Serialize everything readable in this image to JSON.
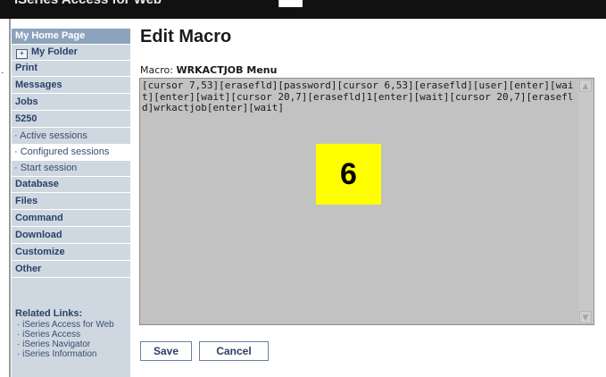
{
  "window": {
    "title_fragment": "iSeries Access for Web"
  },
  "nav": {
    "items": [
      {
        "label": "My Home Page"
      },
      {
        "label": "My Folder"
      },
      {
        "label": "Print"
      },
      {
        "label": "Messages"
      },
      {
        "label": "Jobs"
      },
      {
        "label": "5250"
      },
      {
        "label": "· Active sessions"
      },
      {
        "label": "· Configured sessions"
      },
      {
        "label": "· Start session"
      },
      {
        "label": "Database"
      },
      {
        "label": "Files"
      },
      {
        "label": "Command"
      },
      {
        "label": "Download"
      },
      {
        "label": "Customize"
      },
      {
        "label": "Other"
      }
    ],
    "related": {
      "heading": "Related Links:",
      "links": [
        "· iSeries Access for Web",
        "· iSeries Access",
        "· iSeries Navigator",
        "· iSeries Information"
      ]
    }
  },
  "main": {
    "title": "Edit Macro",
    "macro_label": "Macro: ",
    "macro_name": "WRKACTJOB Menu",
    "macro_text": "[cursor 7,53][erasefld][password][cursor 6,53][erasefld][user][enter][wait][enter][wait][cursor 20,7][erasefld]1[enter][wait][cursor 20,7][erasefld]wrkactjob[enter][wait]",
    "callout_number": "6",
    "buttons": {
      "save": "Save",
      "cancel": "Cancel"
    }
  },
  "icons": {
    "folder": "folder-icon",
    "scroll_up": "scroll-up-icon",
    "scroll_down": "scroll-down-icon"
  }
}
